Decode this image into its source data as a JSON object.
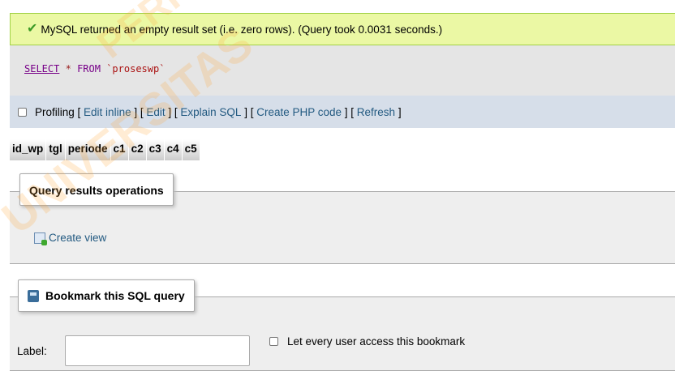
{
  "message": {
    "icon": "success-check-icon",
    "text": "MySQL returned an empty result set (i.e. zero rows). (Query took 0.0031 seconds.)"
  },
  "sql": {
    "select": "SELECT",
    "star": "*",
    "from": "FROM",
    "table": "`proseswp`"
  },
  "profiling": {
    "label": "Profiling",
    "links": [
      "Edit inline",
      "Edit",
      "Explain SQL",
      "Create PHP code",
      "Refresh"
    ]
  },
  "columns": [
    "id_wp",
    "tgl",
    "periode",
    "c1",
    "c2",
    "c3",
    "c4",
    "c5"
  ],
  "query_ops": {
    "legend": "Query results operations",
    "create_view": "Create view"
  },
  "bookmark": {
    "legend": "Bookmark this SQL query",
    "label": "Label:",
    "label_value": "",
    "share_label": "Let every user access this bookmark"
  },
  "watermark": {
    "line1": "UNIVERSITAS",
    "line2": "PERPUSTAKAAN JE YOGYA"
  }
}
